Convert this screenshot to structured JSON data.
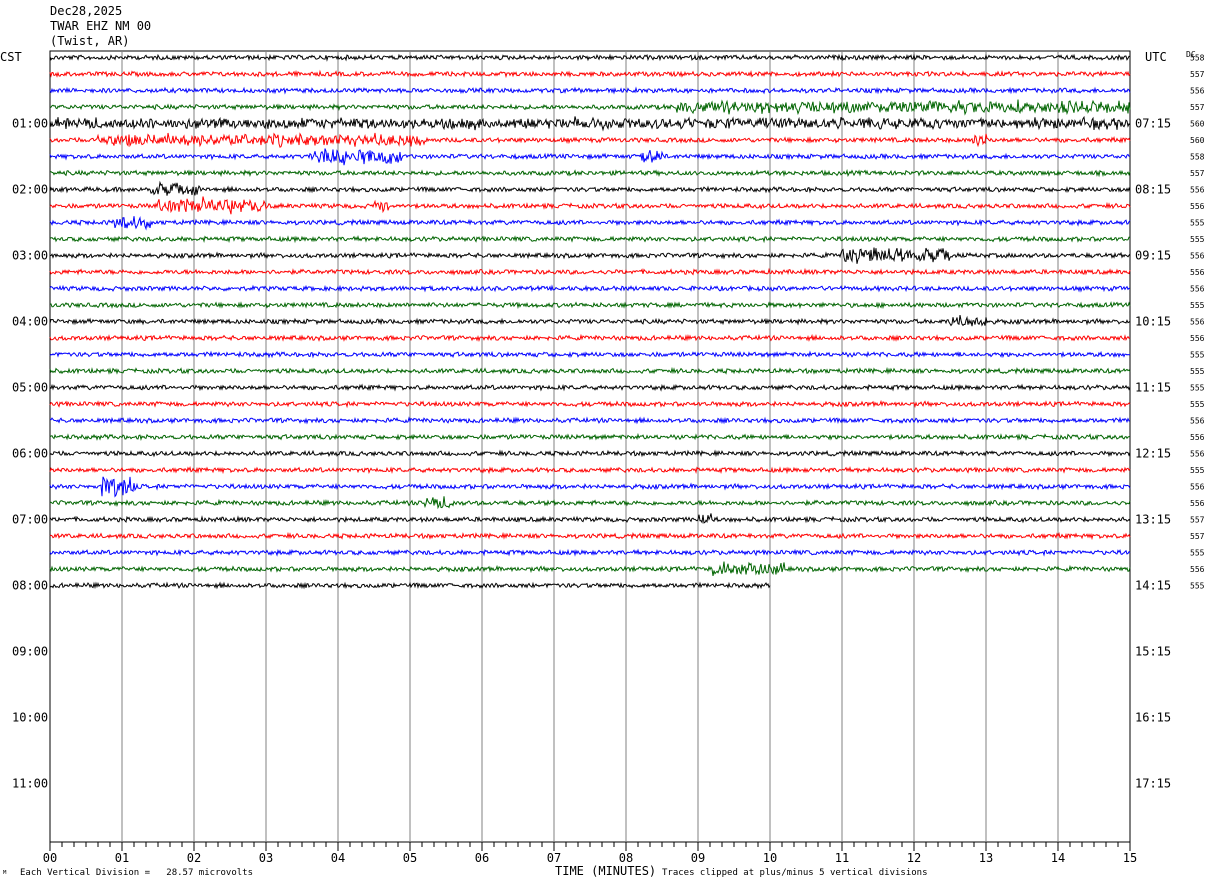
{
  "header": {
    "date": "Dec28,2025",
    "station": "TWAR EHZ NM 00",
    "location": "(Twist, AR)"
  },
  "left_axis_label": "CST",
  "right_axis_label": "UTC",
  "dc_label": "DC",
  "footer": {
    "scale_note": "Each Vertical Division =   28.57 microvolts",
    "xlabel": "TIME (MINUTES)",
    "clip_note": "Traces clipped at plus/minus 5 vertical divisions",
    "corner_mark": "ᴹ"
  },
  "colors": {
    "trace_cycle": [
      "#000000",
      "#ff0000",
      "#0000ff",
      "#006400"
    ],
    "grid": "#808080"
  },
  "chart_data": {
    "type": "line",
    "title": "TWAR EHZ NM 00",
    "xlabel": "TIME (MINUTES)",
    "xlim": [
      0,
      15
    ],
    "x_ticks": [
      "00",
      "01",
      "02",
      "03",
      "04",
      "05",
      "06",
      "07",
      "08",
      "09",
      "10",
      "11",
      "12",
      "13",
      "14",
      "15"
    ],
    "left_hour_labels": [
      "01:00",
      "02:00",
      "03:00",
      "04:00",
      "05:00",
      "06:00",
      "07:00",
      "08:00",
      "09:00",
      "10:00",
      "11:00"
    ],
    "right_hour_labels": [
      "07:15",
      "08:15",
      "09:15",
      "10:15",
      "11:15",
      "12:15",
      "13:15",
      "14:15",
      "15:15",
      "16:15",
      "17:15"
    ],
    "dc_offsets": [
      558,
      557,
      556,
      557,
      560,
      560,
      558,
      557,
      556,
      556,
      555,
      555,
      556,
      556,
      556,
      555,
      556,
      556,
      555,
      555,
      555,
      555,
      556,
      556,
      556,
      555,
      556,
      556,
      557,
      557,
      555,
      556,
      555
    ],
    "rows": 33,
    "last_row_end_minute": 10,
    "events": [
      {
        "row": 3,
        "from_min": 8.7,
        "to_min": 15,
        "amp": 1.6
      },
      {
        "row": 4,
        "from_min": 0,
        "to_min": 15,
        "amp": 1.3
      },
      {
        "row": 5,
        "from_min": 0.6,
        "to_min": 5.2,
        "amp": 1.5
      },
      {
        "row": 5,
        "from_min": 12.8,
        "to_min": 13.0,
        "amp": 3.5
      },
      {
        "row": 6,
        "from_min": 3.6,
        "to_min": 4.9,
        "amp": 2.2
      },
      {
        "row": 6,
        "from_min": 8.2,
        "to_min": 8.5,
        "amp": 1.6
      },
      {
        "row": 8,
        "from_min": 1.4,
        "to_min": 2.1,
        "amp": 1.8
      },
      {
        "row": 9,
        "from_min": 1.5,
        "to_min": 3.0,
        "amp": 2.2
      },
      {
        "row": 9,
        "from_min": 4.5,
        "to_min": 4.7,
        "amp": 2.0
      },
      {
        "row": 10,
        "from_min": 0.9,
        "to_min": 1.4,
        "amp": 1.6
      },
      {
        "row": 12,
        "from_min": 11.0,
        "to_min": 12.5,
        "amp": 2.0
      },
      {
        "row": 16,
        "from_min": 12.5,
        "to_min": 13.0,
        "amp": 1.5
      },
      {
        "row": 26,
        "from_min": 0.7,
        "to_min": 1.2,
        "amp": 3.2
      },
      {
        "row": 27,
        "from_min": 5.2,
        "to_min": 5.6,
        "amp": 1.5
      },
      {
        "row": 28,
        "from_min": 9.0,
        "to_min": 9.2,
        "amp": 1.6
      },
      {
        "row": 31,
        "from_min": 9.2,
        "to_min": 10.2,
        "amp": 2.2
      }
    ]
  }
}
